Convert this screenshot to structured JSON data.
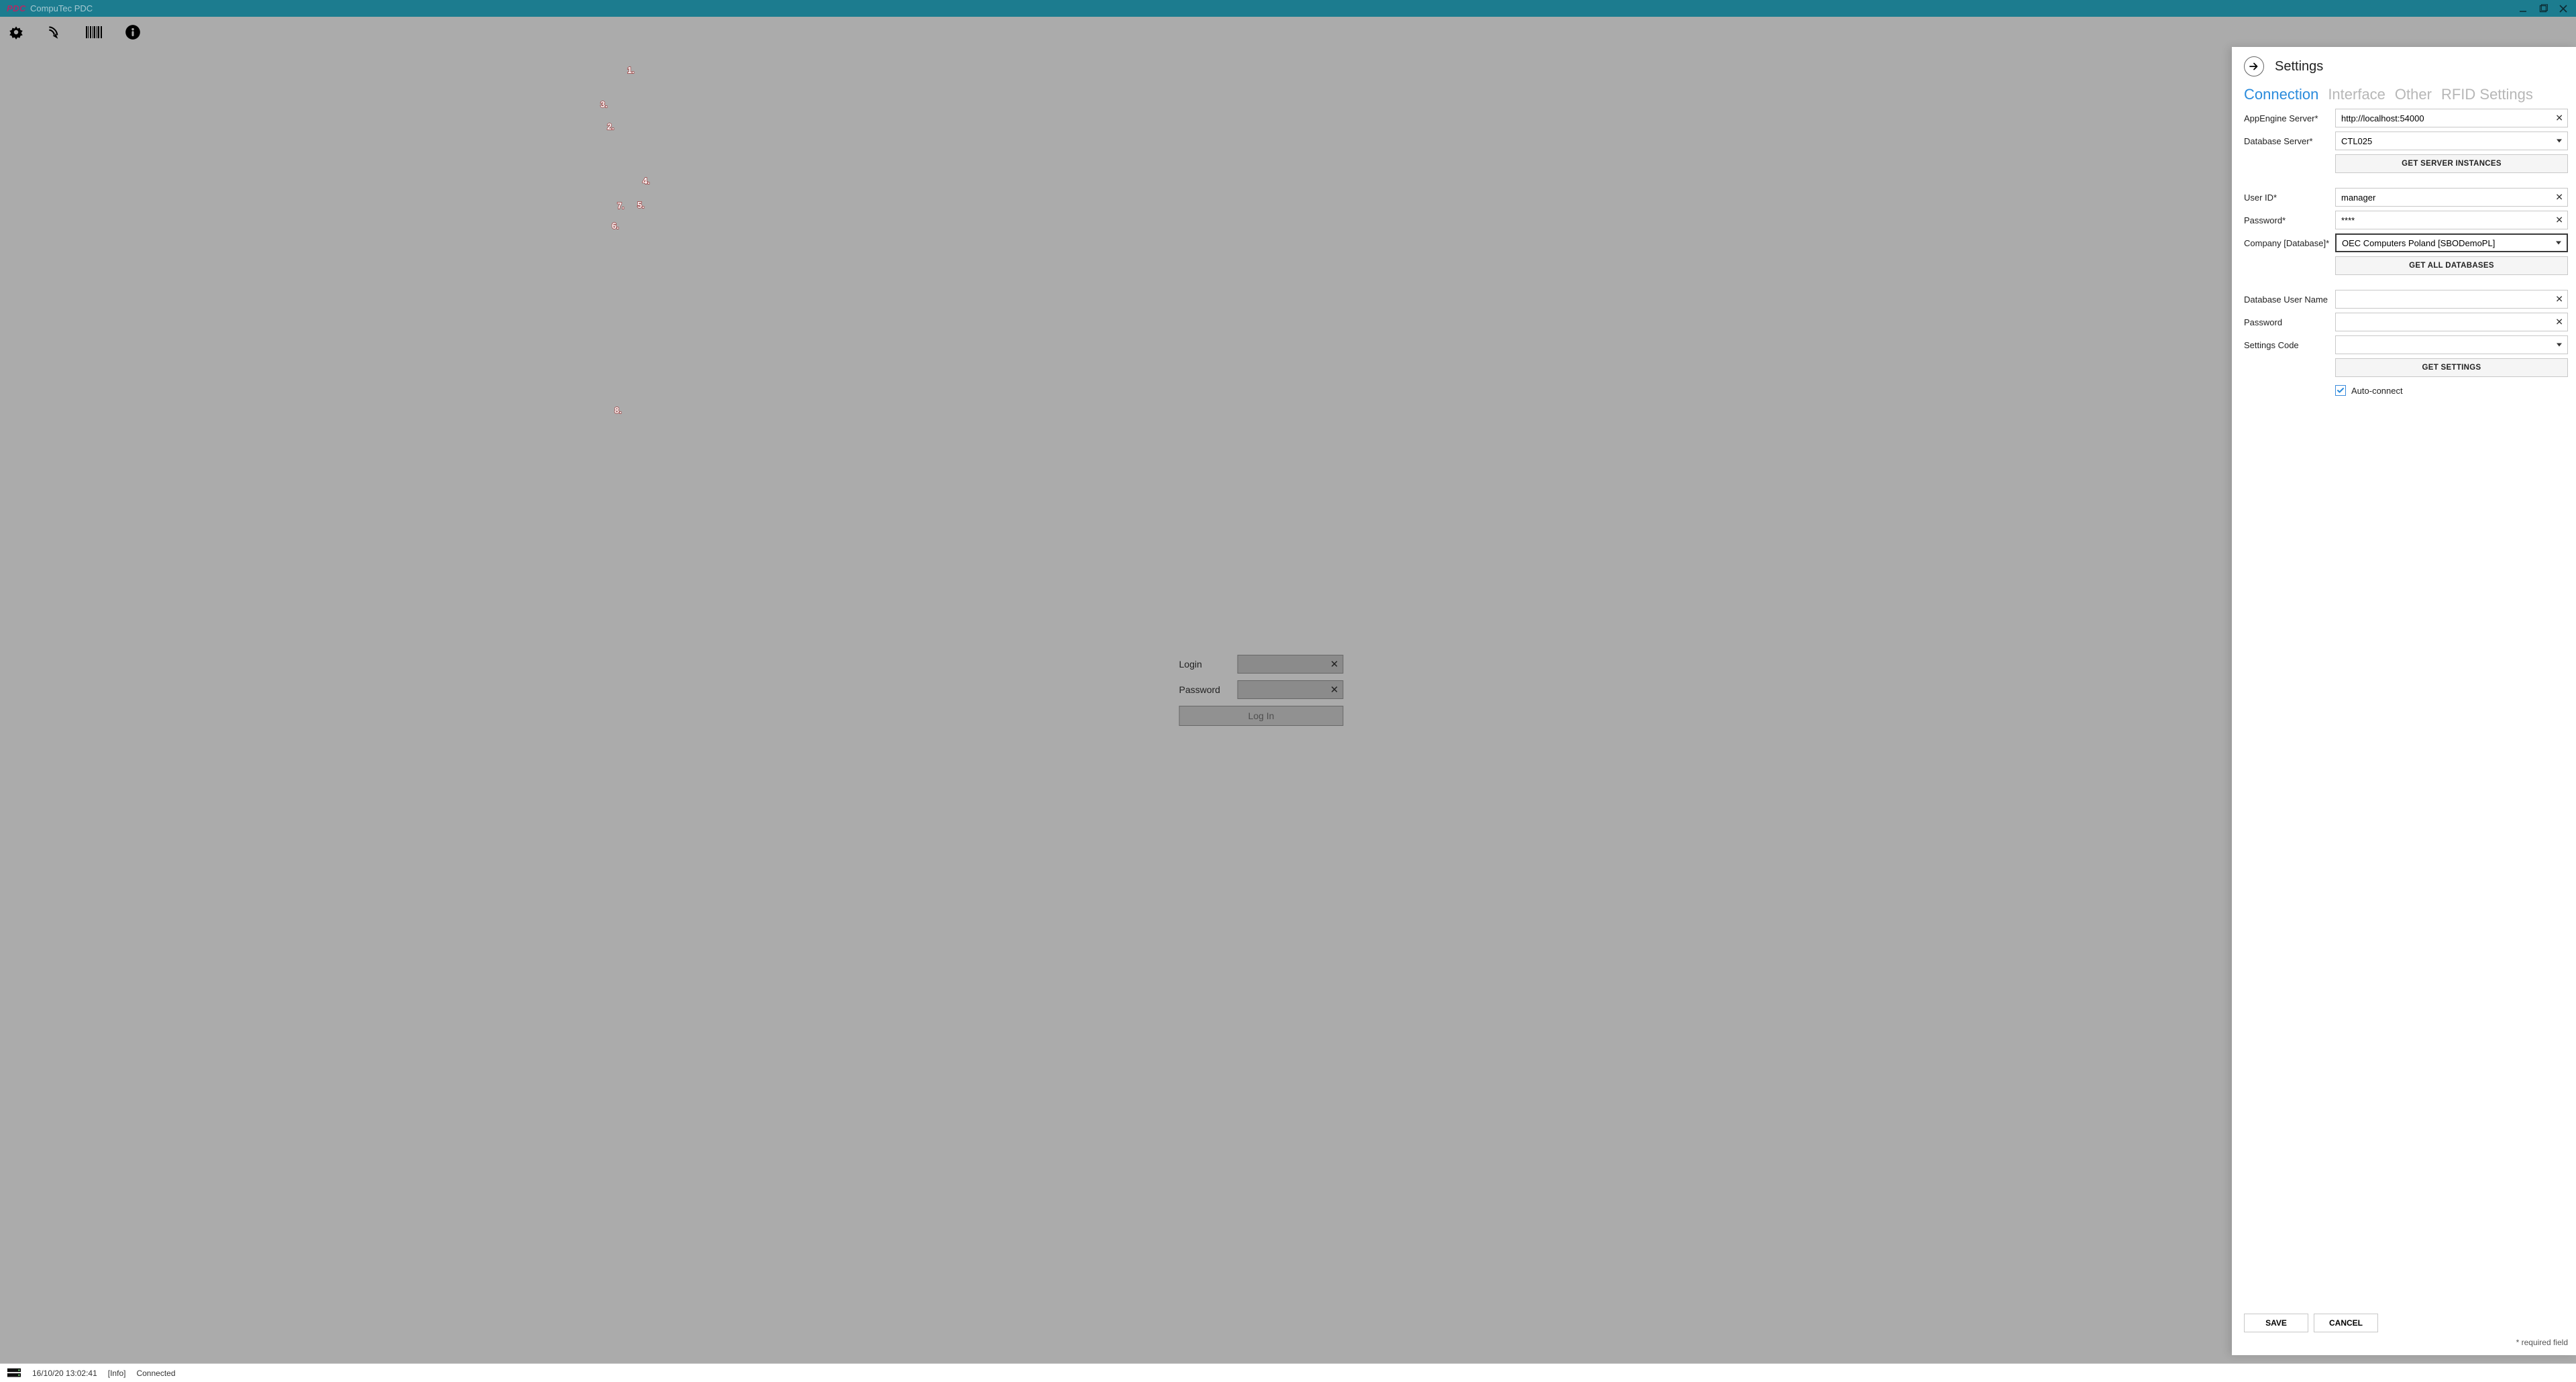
{
  "titlebar": {
    "brand": "PDC",
    "title": "CompuTec PDC"
  },
  "login": {
    "login_label": "Login",
    "password_label": "Password",
    "button": "Log In"
  },
  "panel": {
    "title": "Settings",
    "tabs": {
      "connection": "Connection",
      "interface": "Interface",
      "other": "Other",
      "rfid": "RFID Settings"
    },
    "fields": {
      "appengine_label": "AppEngine Server*",
      "appengine_value": "http://localhost:54000",
      "dbserver_label": "Database Server*",
      "dbserver_value": "CTL025",
      "get_instances": "GET SERVER INSTANCES",
      "userid_label": "User ID*",
      "userid_value": "manager",
      "password_label": "Password*",
      "password_value": "****",
      "company_label": "Company [Database]*",
      "company_value": "OEC Computers Poland [SBODemoPL]",
      "get_databases": "GET ALL DATABASES",
      "dbuser_label": "Database User Name",
      "dbuser_value": "",
      "dbpass_label": "Password",
      "dbpass_value": "",
      "settings_code_label": "Settings Code",
      "settings_code_value": "",
      "get_settings": "GET SETTINGS",
      "auto_connect_label": "Auto-connect",
      "auto_connect_checked": true
    },
    "footer": {
      "save": "SAVE",
      "cancel": "CANCEL",
      "required": "* required field"
    }
  },
  "annotations": {
    "n1": "1.",
    "n2": "2.",
    "n3": "3.",
    "n4": "4.",
    "n5": "5.",
    "n6": "6.",
    "n7": "7.",
    "n8": "8."
  },
  "statusbar": {
    "timestamp": "16/10/20 13:02:41",
    "level": "[Info]",
    "message": "Connected"
  }
}
